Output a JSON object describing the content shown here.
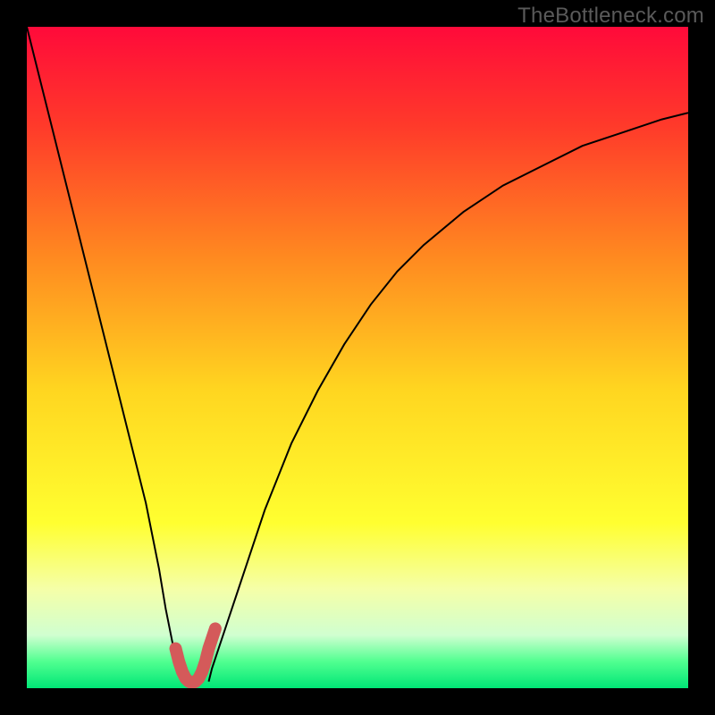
{
  "watermark": "TheBottleneck.com",
  "chart_data": {
    "type": "line",
    "title": "",
    "xlabel": "",
    "ylabel": "",
    "xlim": [
      0,
      100
    ],
    "ylim": [
      0,
      100
    ],
    "gradient_stops": [
      {
        "offset": 0.0,
        "color": "#ff0a3a"
      },
      {
        "offset": 0.15,
        "color": "#ff3a2a"
      },
      {
        "offset": 0.35,
        "color": "#ff8a20"
      },
      {
        "offset": 0.55,
        "color": "#ffd620"
      },
      {
        "offset": 0.75,
        "color": "#ffff30"
      },
      {
        "offset": 0.85,
        "color": "#f5ffa8"
      },
      {
        "offset": 0.92,
        "color": "#d0ffd0"
      },
      {
        "offset": 0.96,
        "color": "#50ff90"
      },
      {
        "offset": 1.0,
        "color": "#00e676"
      }
    ],
    "series": [
      {
        "name": "left-branch",
        "color": "#000000",
        "stroke_width": 2,
        "x": [
          0,
          2,
          4,
          6,
          8,
          10,
          12,
          14,
          16,
          18,
          20,
          21,
          22,
          23,
          23.5
        ],
        "y": [
          100,
          92,
          84,
          76,
          68,
          60,
          52,
          44,
          36,
          28,
          18,
          12,
          7,
          3,
          1
        ]
      },
      {
        "name": "right-branch",
        "color": "#000000",
        "stroke_width": 2,
        "x": [
          27.5,
          28,
          29,
          30,
          32,
          34,
          36,
          38,
          40,
          44,
          48,
          52,
          56,
          60,
          66,
          72,
          78,
          84,
          90,
          96,
          100
        ],
        "y": [
          1,
          3,
          6,
          9,
          15,
          21,
          27,
          32,
          37,
          45,
          52,
          58,
          63,
          67,
          72,
          76,
          79,
          82,
          84,
          86,
          87
        ]
      },
      {
        "name": "trough-highlight",
        "color": "#d45a5a",
        "stroke_width": 14,
        "linecap": "round",
        "x": [
          22.5,
          23,
          23.5,
          24,
          24.5,
          25,
          25.5,
          26,
          26.5,
          27,
          27.5,
          28,
          28.5
        ],
        "y": [
          6,
          4,
          2.5,
          1.5,
          1,
          0.8,
          1,
          1.5,
          2.5,
          4,
          6,
          7.5,
          9
        ]
      }
    ]
  }
}
